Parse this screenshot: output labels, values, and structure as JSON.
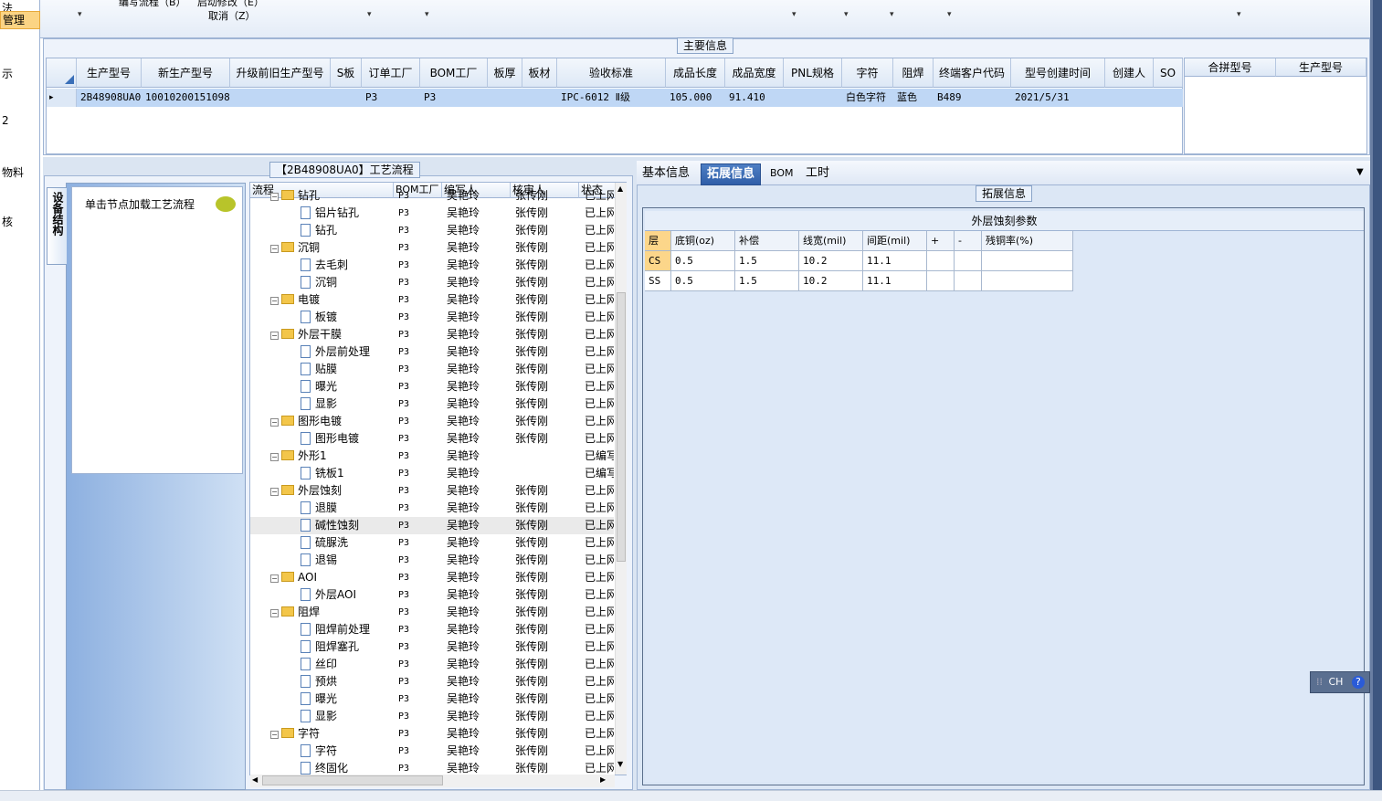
{
  "leftnav": {
    "items": [
      {
        "label": "法"
      },
      {
        "label": "管理"
      },
      {
        "label": "示"
      },
      {
        "label": "2"
      },
      {
        "label": "物料"
      },
      {
        "label": "核"
      }
    ]
  },
  "ribbon": {
    "menu1": "编写流程（B）",
    "menu2": "启动修改（E）",
    "menu3": "取消（Z）"
  },
  "main_info": {
    "group_title": "主要信息",
    "columns": [
      "生产型号",
      "新生产型号",
      "升级前旧生产型号",
      "S板",
      "订单工厂",
      "BOM工厂",
      "板厚",
      "板材",
      "验收标准",
      "成品长度",
      "成品宽度",
      "PNL规格",
      "字符",
      "阻焊",
      "终端客户代码",
      "型号创建时间",
      "创建人",
      "SO"
    ],
    "row": [
      "2B48908UA0",
      "10010200151098",
      "",
      "",
      "P3",
      "P3",
      "",
      "",
      "IPC-6012 Ⅱ级",
      "105.000",
      "91.410",
      "",
      "白色字符",
      "蓝色",
      "B489",
      "2021/5/31",
      "",
      ""
    ],
    "side_columns": [
      "合拼型号",
      "生产型号"
    ]
  },
  "process": {
    "group_title": "【2B48908UA0】工艺流程",
    "vertical_tab": "设备结构",
    "left_item": "单击节点加载工艺流程",
    "columns": [
      "流程",
      "BOM工厂",
      "编写人",
      "核审人",
      "状态"
    ],
    "rows": [
      {
        "name": "钻孔",
        "level": 0,
        "factory": "P3",
        "author": "吴艳玲",
        "reviewer": "张传刚",
        "status": "已上网"
      },
      {
        "name": "铝片钻孔",
        "level": 1,
        "factory": "P3",
        "author": "吴艳玲",
        "reviewer": "张传刚",
        "status": "已上网"
      },
      {
        "name": "钻孔",
        "level": 1,
        "factory": "P3",
        "author": "吴艳玲",
        "reviewer": "张传刚",
        "status": "已上网"
      },
      {
        "name": "沉铜",
        "level": 0,
        "factory": "P3",
        "author": "吴艳玲",
        "reviewer": "张传刚",
        "status": "已上网"
      },
      {
        "name": "去毛刺",
        "level": 1,
        "factory": "P3",
        "author": "吴艳玲",
        "reviewer": "张传刚",
        "status": "已上网"
      },
      {
        "name": "沉铜",
        "level": 1,
        "factory": "P3",
        "author": "吴艳玲",
        "reviewer": "张传刚",
        "status": "已上网"
      },
      {
        "name": "电镀",
        "level": 0,
        "factory": "P3",
        "author": "吴艳玲",
        "reviewer": "张传刚",
        "status": "已上网"
      },
      {
        "name": "板镀",
        "level": 1,
        "factory": "P3",
        "author": "吴艳玲",
        "reviewer": "张传刚",
        "status": "已上网"
      },
      {
        "name": "外层干膜",
        "level": 0,
        "factory": "P3",
        "author": "吴艳玲",
        "reviewer": "张传刚",
        "status": "已上网"
      },
      {
        "name": "外层前处理",
        "level": 1,
        "factory": "P3",
        "author": "吴艳玲",
        "reviewer": "张传刚",
        "status": "已上网"
      },
      {
        "name": "贴膜",
        "level": 1,
        "factory": "P3",
        "author": "吴艳玲",
        "reviewer": "张传刚",
        "status": "已上网"
      },
      {
        "name": "曝光",
        "level": 1,
        "factory": "P3",
        "author": "吴艳玲",
        "reviewer": "张传刚",
        "status": "已上网"
      },
      {
        "name": "显影",
        "level": 1,
        "factory": "P3",
        "author": "吴艳玲",
        "reviewer": "张传刚",
        "status": "已上网"
      },
      {
        "name": "图形电镀",
        "level": 0,
        "factory": "P3",
        "author": "吴艳玲",
        "reviewer": "张传刚",
        "status": "已上网"
      },
      {
        "name": "图形电镀",
        "level": 1,
        "factory": "P3",
        "author": "吴艳玲",
        "reviewer": "张传刚",
        "status": "已上网"
      },
      {
        "name": "外形1",
        "level": 0,
        "factory": "P3",
        "author": "吴艳玲",
        "reviewer": "",
        "status": "已编写"
      },
      {
        "name": "铣板1",
        "level": 1,
        "factory": "P3",
        "author": "吴艳玲",
        "reviewer": "",
        "status": "已编写"
      },
      {
        "name": "外层蚀刻",
        "level": 0,
        "factory": "P3",
        "author": "吴艳玲",
        "reviewer": "张传刚",
        "status": "已上网"
      },
      {
        "name": "退膜",
        "level": 1,
        "factory": "P3",
        "author": "吴艳玲",
        "reviewer": "张传刚",
        "status": "已上网"
      },
      {
        "name": "碱性蚀刻",
        "level": 1,
        "factory": "P3",
        "author": "吴艳玲",
        "reviewer": "张传刚",
        "status": "已上网",
        "selected": true
      },
      {
        "name": "硫脲洗",
        "level": 1,
        "factory": "P3",
        "author": "吴艳玲",
        "reviewer": "张传刚",
        "status": "已上网"
      },
      {
        "name": "退锡",
        "level": 1,
        "factory": "P3",
        "author": "吴艳玲",
        "reviewer": "张传刚",
        "status": "已上网"
      },
      {
        "name": "AOI",
        "level": 0,
        "factory": "P3",
        "author": "吴艳玲",
        "reviewer": "张传刚",
        "status": "已上网"
      },
      {
        "name": "外层AOI",
        "level": 1,
        "factory": "P3",
        "author": "吴艳玲",
        "reviewer": "张传刚",
        "status": "已上网"
      },
      {
        "name": "阻焊",
        "level": 0,
        "factory": "P3",
        "author": "吴艳玲",
        "reviewer": "张传刚",
        "status": "已上网"
      },
      {
        "name": "阻焊前处理",
        "level": 1,
        "factory": "P3",
        "author": "吴艳玲",
        "reviewer": "张传刚",
        "status": "已上网"
      },
      {
        "name": "阻焊塞孔",
        "level": 1,
        "factory": "P3",
        "author": "吴艳玲",
        "reviewer": "张传刚",
        "status": "已上网"
      },
      {
        "name": "丝印",
        "level": 1,
        "factory": "P3",
        "author": "吴艳玲",
        "reviewer": "张传刚",
        "status": "已上网"
      },
      {
        "name": "预烘",
        "level": 1,
        "factory": "P3",
        "author": "吴艳玲",
        "reviewer": "张传刚",
        "status": "已上网"
      },
      {
        "name": "曝光",
        "level": 1,
        "factory": "P3",
        "author": "吴艳玲",
        "reviewer": "张传刚",
        "status": "已上网"
      },
      {
        "name": "显影",
        "level": 1,
        "factory": "P3",
        "author": "吴艳玲",
        "reviewer": "张传刚",
        "status": "已上网"
      },
      {
        "name": "字符",
        "level": 0,
        "factory": "P3",
        "author": "吴艳玲",
        "reviewer": "张传刚",
        "status": "已上网"
      },
      {
        "name": "字符",
        "level": 1,
        "factory": "P3",
        "author": "吴艳玲",
        "reviewer": "张传刚",
        "status": "已上网"
      },
      {
        "name": "终固化",
        "level": 1,
        "factory": "P3",
        "author": "吴艳玲",
        "reviewer": "张传刚",
        "status": "已上网"
      }
    ]
  },
  "right_tabs": {
    "tabs": [
      "基本信息",
      "拓展信息",
      "BOM",
      "工时"
    ],
    "active": "拓展信息",
    "group_title": "拓展信息"
  },
  "etch_params": {
    "title": "外层蚀刻参数",
    "columns": [
      "层",
      "底铜(oz)",
      "补偿",
      "线宽(mil)",
      "间距(mil)",
      "+",
      "-",
      "残铜率(%)"
    ],
    "rows": [
      [
        "CS",
        "0.5",
        "1.5",
        "10.2",
        "11.1",
        "",
        "",
        ""
      ],
      [
        "SS",
        "0.5",
        "1.5",
        "10.2",
        "11.1",
        "",
        "",
        ""
      ]
    ]
  },
  "ime": {
    "label": "CH"
  }
}
